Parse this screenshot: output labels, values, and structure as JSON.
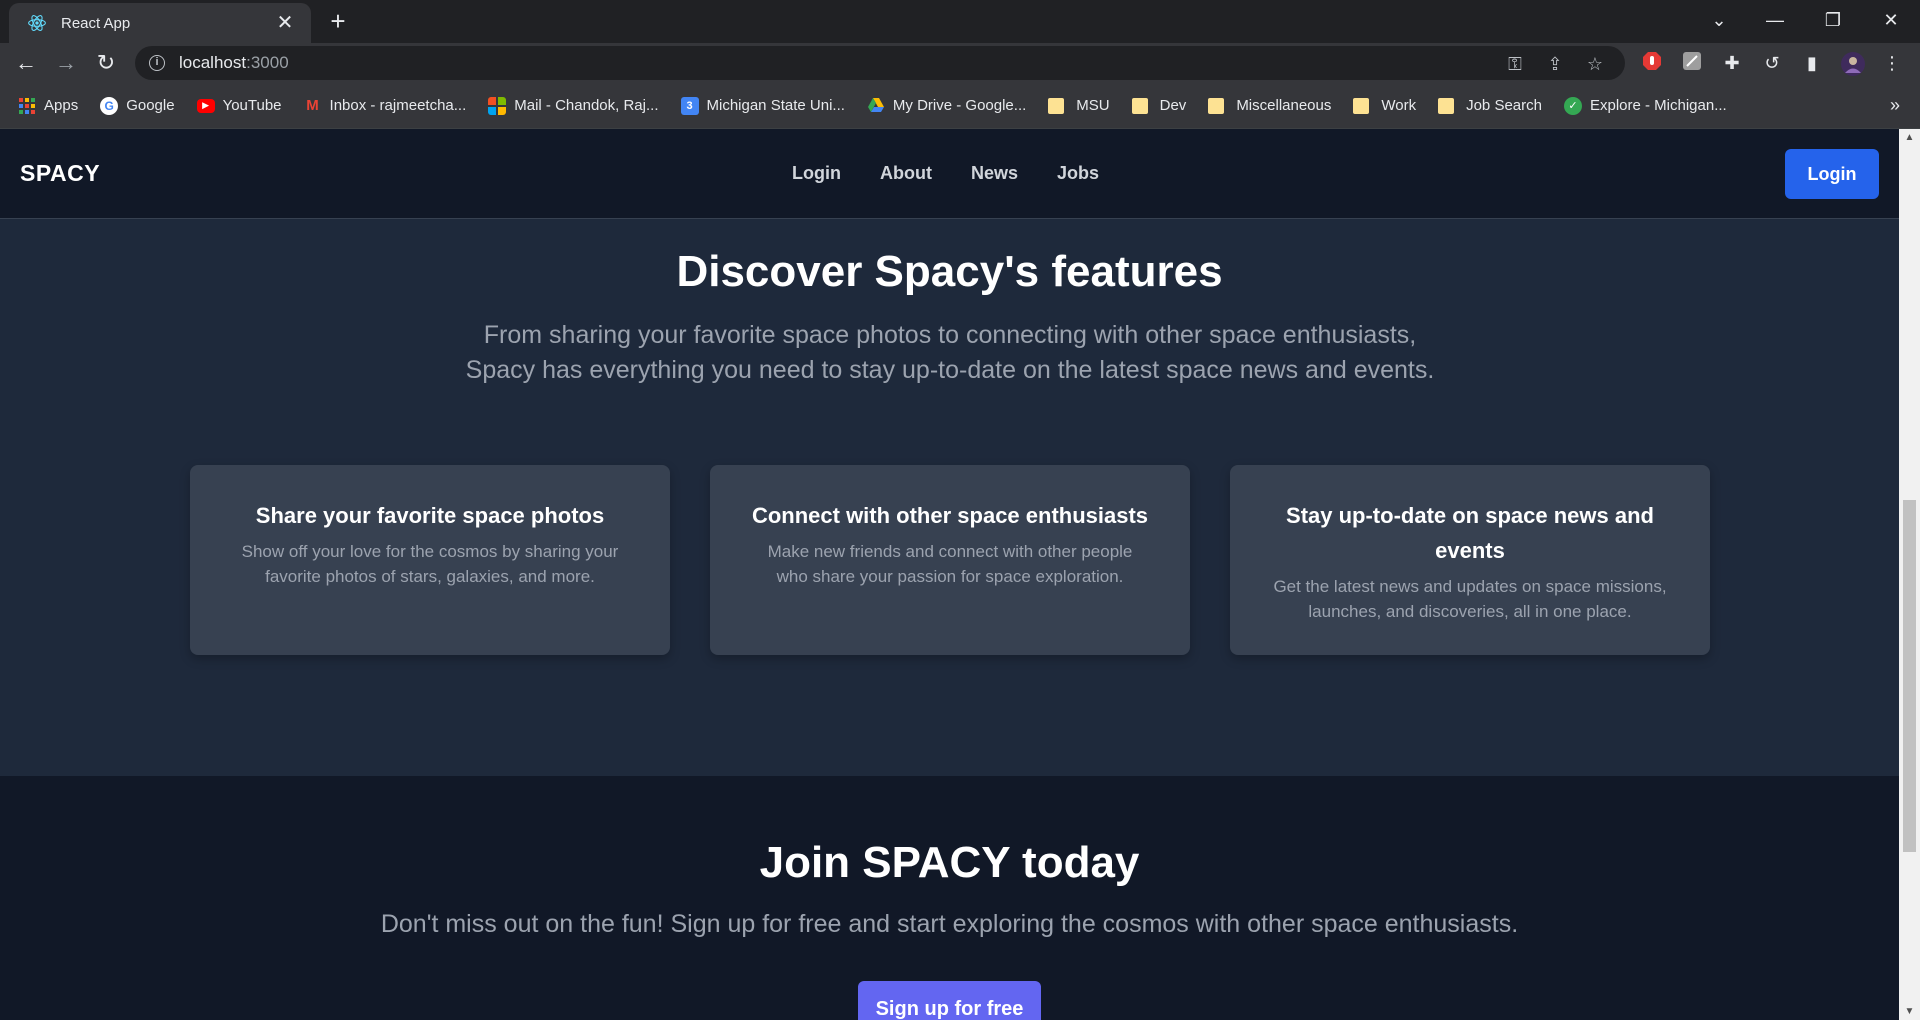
{
  "browser": {
    "tab_title": "React App",
    "tab_close": "✕",
    "new_tab": "+",
    "url_host": "localhost",
    "url_port": ":3000",
    "bookmarks": [
      {
        "label": "Apps",
        "icon": "apps-grid-icon"
      },
      {
        "label": "Google",
        "icon": "google-icon"
      },
      {
        "label": "YouTube",
        "icon": "youtube-icon"
      },
      {
        "label": "Inbox - rajmeetcha...",
        "icon": "gmail-icon"
      },
      {
        "label": "Mail - Chandok, Raj...",
        "icon": "microsoft-icon"
      },
      {
        "label": "Michigan State Uni...",
        "icon": "calendar-icon"
      },
      {
        "label": "My Drive - Google...",
        "icon": "drive-icon"
      },
      {
        "label": "MSU",
        "icon": "folder-icon"
      },
      {
        "label": "Dev",
        "icon": "folder-icon"
      },
      {
        "label": "Miscellaneous",
        "icon": "folder-icon"
      },
      {
        "label": "Work",
        "icon": "folder-icon"
      },
      {
        "label": "Job Search",
        "icon": "folder-icon"
      },
      {
        "label": "Explore - Michigan...",
        "icon": "check-logo-icon"
      }
    ],
    "bookmarks_more": "»"
  },
  "site": {
    "brand": "SPACY",
    "nav": [
      "Login",
      "About",
      "News",
      "Jobs"
    ],
    "login_button": "Login"
  },
  "features": {
    "title": "Discover Spacy's features",
    "subtitle_line1": "From sharing your favorite space photos to connecting with other space enthusiasts,",
    "subtitle_line2": "Spacy has everything you need to stay up-to-date on the latest space news and events.",
    "cards": [
      {
        "title": "Share your favorite space photos",
        "text": "Show off your love for the cosmos by sharing your favorite photos of stars, galaxies, and more."
      },
      {
        "title": "Connect with other space enthusiasts",
        "text": "Make new friends and connect with other people who share your passion for space exploration."
      },
      {
        "title": "Stay up-to-date on space news and events",
        "text": "Get the latest news and updates on space missions, launches, and discoveries, all in one place."
      }
    ]
  },
  "join": {
    "title": "Join SPACY today",
    "subtitle": "Don't miss out on the fun! Sign up for free and start exploring the cosmos with other space enthusiasts.",
    "button": "Sign up for free"
  },
  "colors": {
    "nav_bg": "#111827",
    "section_bg": "#1e293b",
    "card_bg": "#374151",
    "primary": "#2563eb",
    "indigo": "#6366f1"
  }
}
